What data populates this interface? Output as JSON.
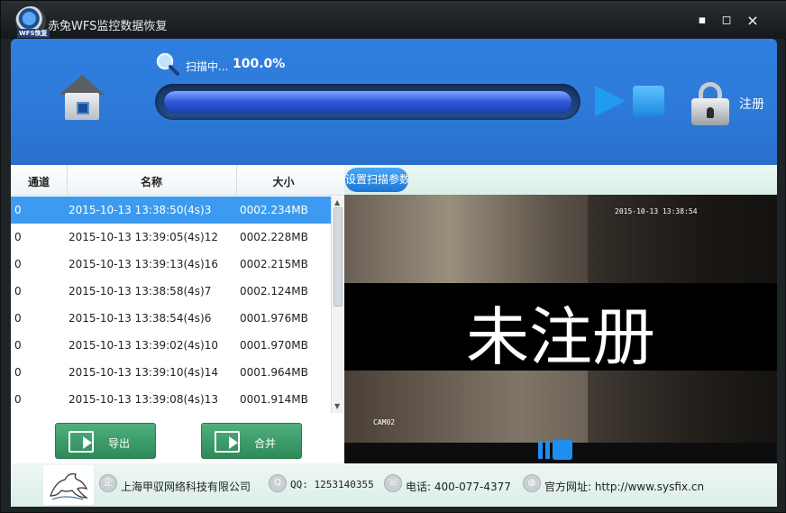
{
  "window": {
    "title": "赤兔WFS监控数据恢复",
    "logo_text": "WFS恢复",
    "minimize": "▪",
    "maximize": "◻",
    "close": "×"
  },
  "header": {
    "scan_label": "扫描中...",
    "scan_percent": "100.0%",
    "progress_fraction": 1.0,
    "register_label": "注册",
    "colors": {
      "header_bg": "#2d79d8",
      "progress_fill": "#2e58d8"
    }
  },
  "table": {
    "columns": [
      "通道",
      "名称",
      "大小"
    ],
    "rows": [
      {
        "channel": "0",
        "name": "2015-10-13 13:38:50(4s)3",
        "size": "0002.234MB",
        "selected": true
      },
      {
        "channel": "0",
        "name": "2015-10-13 13:39:05(4s)12",
        "size": "0002.228MB",
        "selected": false
      },
      {
        "channel": "0",
        "name": "2015-10-13 13:39:13(4s)16",
        "size": "0002.215MB",
        "selected": false
      },
      {
        "channel": "0",
        "name": "2015-10-13 13:38:58(4s)7",
        "size": "0002.124MB",
        "selected": false
      },
      {
        "channel": "0",
        "name": "2015-10-13 13:38:54(4s)6",
        "size": "0001.976MB",
        "selected": false
      },
      {
        "channel": "0",
        "name": "2015-10-13 13:39:02(4s)10",
        "size": "0001.970MB",
        "selected": false
      },
      {
        "channel": "0",
        "name": "2015-10-13 13:39:10(4s)14",
        "size": "0001.964MB",
        "selected": false
      },
      {
        "channel": "0",
        "name": "2015-10-13 13:39:08(4s)13",
        "size": "0001.914MB",
        "selected": false
      }
    ]
  },
  "actions": {
    "export_label": "导出",
    "merge_label": "合并"
  },
  "preview": {
    "settings_button": "设置扫描参数",
    "overlay_text": "未注册",
    "timestamp": "2015-10-13 13:38:54",
    "camera_label": "CAM02"
  },
  "footer": {
    "company": "上海甲驭网络科技有限公司",
    "qq": "QQ: 1253140355",
    "phone": "电话: 400-077-4377",
    "website": "官方网址: http://www.sysfix.cn"
  }
}
